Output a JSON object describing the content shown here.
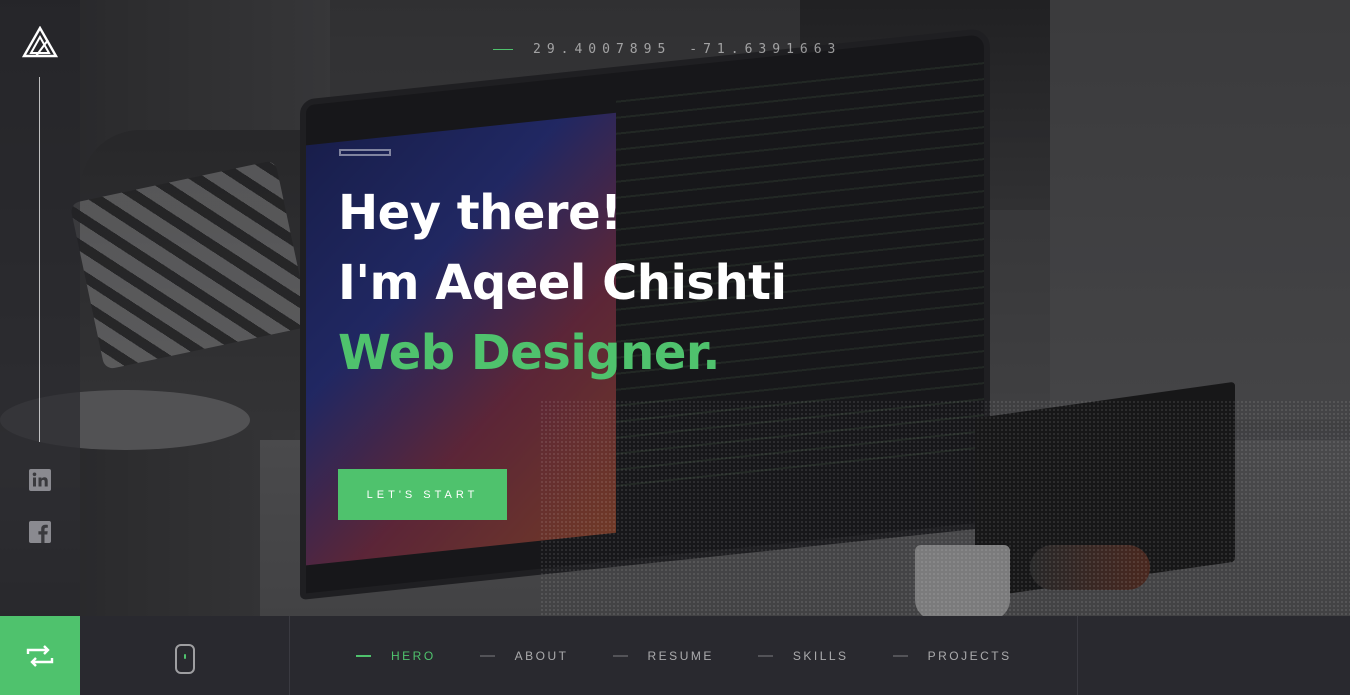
{
  "coordinates": {
    "latitude": "29.4007895",
    "longitude": "-71.6391663"
  },
  "hero": {
    "greeting": "Hey there!",
    "name_line": "I'm Aqeel Chishti",
    "role": "Web Designer.",
    "cta_label": "LET'S START"
  },
  "sidebar": {
    "social": [
      {
        "name": "linkedin-icon"
      },
      {
        "name": "facebook-icon"
      }
    ]
  },
  "nav": {
    "items": [
      {
        "label": "HERO",
        "active": true
      },
      {
        "label": "ABOUT",
        "active": false
      },
      {
        "label": "RESUME",
        "active": false
      },
      {
        "label": "SKILLS",
        "active": false
      },
      {
        "label": "PROJECTS",
        "active": false
      }
    ]
  },
  "colors": {
    "accent": "#4fc26d",
    "bottom_bar": "#29292f"
  }
}
